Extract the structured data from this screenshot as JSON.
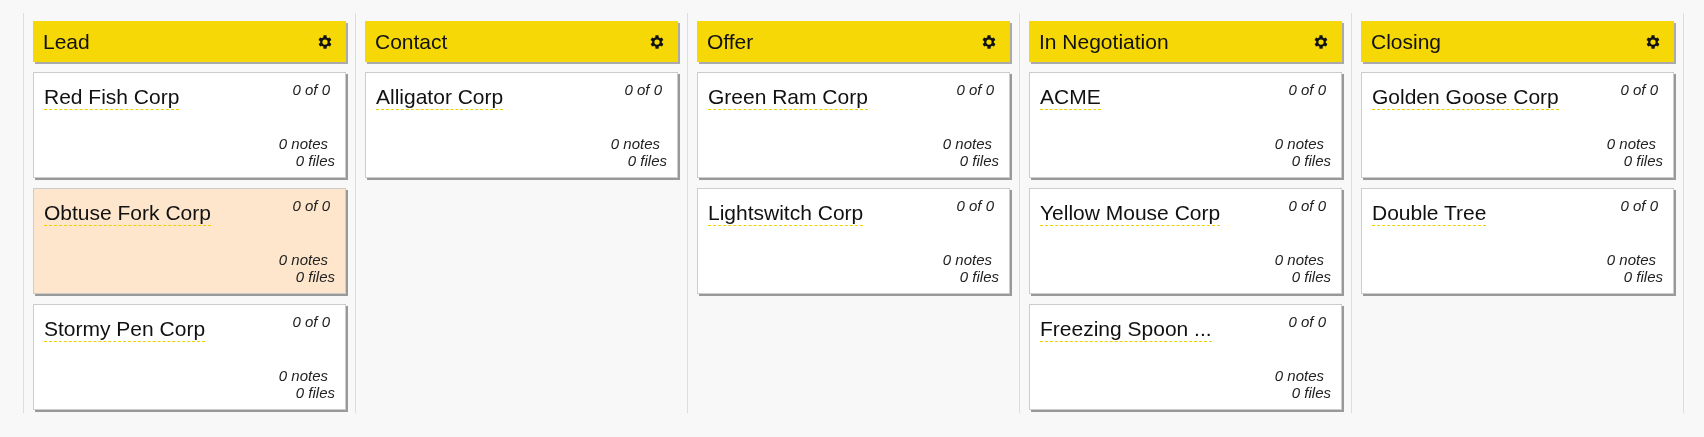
{
  "columns": [
    {
      "title": "Lead",
      "cards": [
        {
          "name": "Red Fish Corp",
          "progress": "0 of 0",
          "notes": "0 notes",
          "files": "0 files",
          "selected": false
        },
        {
          "name": "Obtuse Fork Corp",
          "progress": "0 of 0",
          "notes": "0 notes",
          "files": "0 files",
          "selected": true
        },
        {
          "name": "Stormy Pen Corp",
          "progress": "0 of 0",
          "notes": "0 notes",
          "files": "0 files",
          "selected": false
        }
      ]
    },
    {
      "title": "Contact",
      "cards": [
        {
          "name": "Alligator Corp",
          "progress": "0 of 0",
          "notes": "0 notes",
          "files": "0 files",
          "selected": false
        }
      ]
    },
    {
      "title": "Offer",
      "cards": [
        {
          "name": "Green Ram Corp",
          "progress": "0 of 0",
          "notes": "0 notes",
          "files": "0 files",
          "selected": false
        },
        {
          "name": "Lightswitch Corp",
          "progress": "0 of 0",
          "notes": "0 notes",
          "files": "0 files",
          "selected": false
        }
      ]
    },
    {
      "title": "In Negotiation",
      "cards": [
        {
          "name": "ACME",
          "progress": "0 of 0",
          "notes": "0 notes",
          "files": "0 files",
          "selected": false
        },
        {
          "name": "Yellow Mouse Corp",
          "progress": "0 of 0",
          "notes": "0 notes",
          "files": "0 files",
          "selected": false
        },
        {
          "name": "Freezing Spoon ...",
          "progress": "0 of 0",
          "notes": "0 notes",
          "files": "0 files",
          "selected": false
        }
      ]
    },
    {
      "title": "Closing",
      "cards": [
        {
          "name": "Golden Goose Corp",
          "progress": "0 of 0",
          "notes": "0 notes",
          "files": "0 files",
          "selected": false
        },
        {
          "name": "Double Tree",
          "progress": "0 of 0",
          "notes": "0 notes",
          "files": "0 files",
          "selected": false
        }
      ]
    }
  ]
}
